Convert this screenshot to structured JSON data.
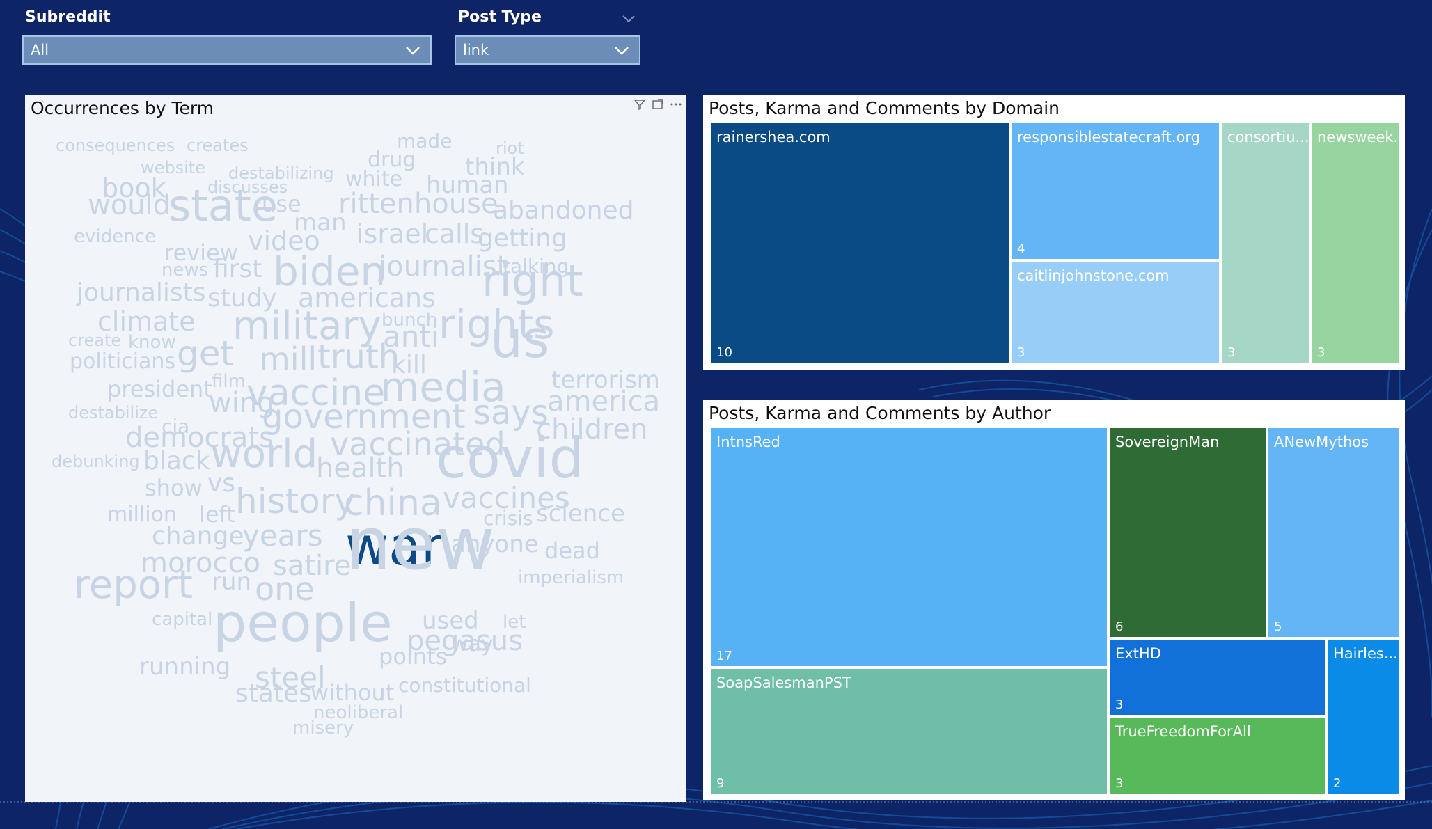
{
  "colors": {
    "background": "#0d2466",
    "treemap_domain": [
      "#0a4a85",
      "#64b5f6",
      "#98cdf8",
      "#a5d6c6",
      "#98d4a0"
    ],
    "treemap_author": [
      "#56b1f5",
      "#2f6b35",
      "#64b5f6",
      "#6fbfa8",
      "#1171d8",
      "#57b95a",
      "#0a8be8"
    ]
  },
  "filters": {
    "subreddit": {
      "label": "Subreddit",
      "value": "All"
    },
    "post_type": {
      "label": "Post Type",
      "value": "link"
    }
  },
  "wordcloud": {
    "title": "Occurrences by Term",
    "words": [
      {
        "t": "consequences",
        "s": 24
      },
      {
        "t": "creates",
        "s": 24
      },
      {
        "t": "made",
        "s": 28
      },
      {
        "t": "riot",
        "s": 24
      },
      {
        "t": "website",
        "s": 24
      },
      {
        "t": "drug",
        "s": 30
      },
      {
        "t": "destabilizing",
        "s": 24
      },
      {
        "t": "think",
        "s": 34
      },
      {
        "t": "white",
        "s": 30
      },
      {
        "t": "book",
        "s": 38
      },
      {
        "t": "discusses",
        "s": 24
      },
      {
        "t": "human",
        "s": 34
      },
      {
        "t": "would",
        "s": 40
      },
      {
        "t": "state",
        "s": 62
      },
      {
        "t": "use",
        "s": 32
      },
      {
        "t": "rittenhouse",
        "s": 40
      },
      {
        "t": "abandoned",
        "s": 36
      },
      {
        "t": "man",
        "s": 34
      },
      {
        "t": "evidence",
        "s": 26
      },
      {
        "t": "israel",
        "s": 38
      },
      {
        "t": "calls",
        "s": 38
      },
      {
        "t": "getting",
        "s": 36
      },
      {
        "t": "review",
        "s": 32
      },
      {
        "t": "video",
        "s": 38
      },
      {
        "t": "news",
        "s": 26
      },
      {
        "t": "first",
        "s": 36
      },
      {
        "t": "biden",
        "s": 58
      },
      {
        "t": "journalist",
        "s": 40
      },
      {
        "t": "talking",
        "s": 28
      },
      {
        "t": "journalists",
        "s": 36
      },
      {
        "t": "study",
        "s": 36
      },
      {
        "t": "right",
        "s": 62
      },
      {
        "t": "americans",
        "s": 38
      },
      {
        "t": "climate",
        "s": 38
      },
      {
        "t": "bunch",
        "s": 26
      },
      {
        "t": "military",
        "s": 56
      },
      {
        "t": "create",
        "s": 24
      },
      {
        "t": "know",
        "s": 26
      },
      {
        "t": "anti",
        "s": 42
      },
      {
        "t": "rights",
        "s": 58
      },
      {
        "t": "politicians",
        "s": 30
      },
      {
        "t": "get",
        "s": 50
      },
      {
        "t": "mill",
        "s": 46
      },
      {
        "t": "truth",
        "s": 48
      },
      {
        "t": "kill",
        "s": 36
      },
      {
        "t": "us",
        "s": 74
      },
      {
        "t": "terrorism",
        "s": 34
      },
      {
        "t": "film",
        "s": 26
      },
      {
        "t": "president",
        "s": 32
      },
      {
        "t": "media",
        "s": 58
      },
      {
        "t": "vaccine",
        "s": 52
      },
      {
        "t": "america",
        "s": 40
      },
      {
        "t": "destabilize",
        "s": 24
      },
      {
        "t": "cia",
        "s": 28
      },
      {
        "t": "wing",
        "s": 40
      },
      {
        "t": "government",
        "s": 48
      },
      {
        "t": "says",
        "s": 48
      },
      {
        "t": "children",
        "s": 40
      },
      {
        "t": "democrats",
        "s": 40
      },
      {
        "t": "vaccinated",
        "s": 46
      },
      {
        "t": "debunking",
        "s": 24
      },
      {
        "t": "black",
        "s": 36
      },
      {
        "t": "world",
        "s": 56
      },
      {
        "t": "health",
        "s": 40
      },
      {
        "t": "covid",
        "s": 80
      },
      {
        "t": "show",
        "s": 32
      },
      {
        "t": "vs",
        "s": 36
      },
      {
        "t": "history",
        "s": 50
      },
      {
        "t": "china",
        "s": 52
      },
      {
        "t": "vaccines",
        "s": 42
      },
      {
        "t": "million",
        "s": 30
      },
      {
        "t": "left",
        "s": 32
      },
      {
        "t": "crisis",
        "s": 28
      },
      {
        "t": "science",
        "s": 34
      },
      {
        "t": "change",
        "s": 36
      },
      {
        "t": "years",
        "s": 42
      },
      {
        "t": "war",
        "s": 76
      },
      {
        "t": "anyone",
        "s": 34
      },
      {
        "t": "dead",
        "s": 32
      },
      {
        "t": "morocco",
        "s": 40
      },
      {
        "t": "satire",
        "s": 40
      },
      {
        "t": "new",
        "s": 104
      },
      {
        "t": "imperialism",
        "s": 26
      },
      {
        "t": "report",
        "s": 56
      },
      {
        "t": "run",
        "s": 34
      },
      {
        "t": "one",
        "s": 46
      },
      {
        "t": "capital",
        "s": 26
      },
      {
        "t": "people",
        "s": 76
      },
      {
        "t": "used",
        "s": 34
      },
      {
        "t": "let",
        "s": 26
      },
      {
        "t": "pegasus",
        "s": 40
      },
      {
        "t": "way",
        "s": 30
      },
      {
        "t": "points",
        "s": 32
      },
      {
        "t": "running",
        "s": 34
      },
      {
        "t": "steel",
        "s": 42
      },
      {
        "t": "constitutional",
        "s": 28
      },
      {
        "t": "states",
        "s": 36
      },
      {
        "t": "without",
        "s": 32
      },
      {
        "t": "neoliberal",
        "s": 26
      },
      {
        "t": "misery",
        "s": 26
      }
    ]
  },
  "domain_treemap": {
    "title": "Posts, Karma and Comments by Domain",
    "cells": [
      {
        "name": "rainershea.com",
        "value": "10"
      },
      {
        "name": "responsiblestatecraft.org",
        "value": "4"
      },
      {
        "name": "caitlinjohnstone.com",
        "value": "3"
      },
      {
        "name": "consortiu...",
        "value": "3"
      },
      {
        "name": "newsweek...",
        "value": "3"
      }
    ]
  },
  "author_treemap": {
    "title": "Posts, Karma and Comments by Author",
    "cells": [
      {
        "name": "IntnsRed",
        "value": "17"
      },
      {
        "name": "SovereignMan",
        "value": "6"
      },
      {
        "name": "ANewMythos",
        "value": "5"
      },
      {
        "name": "SoapSalesmanPST",
        "value": "9"
      },
      {
        "name": "ExtHD",
        "value": "3"
      },
      {
        "name": "TrueFreedomForAll",
        "value": "3"
      },
      {
        "name": "Hairles...",
        "value": "2"
      }
    ]
  }
}
